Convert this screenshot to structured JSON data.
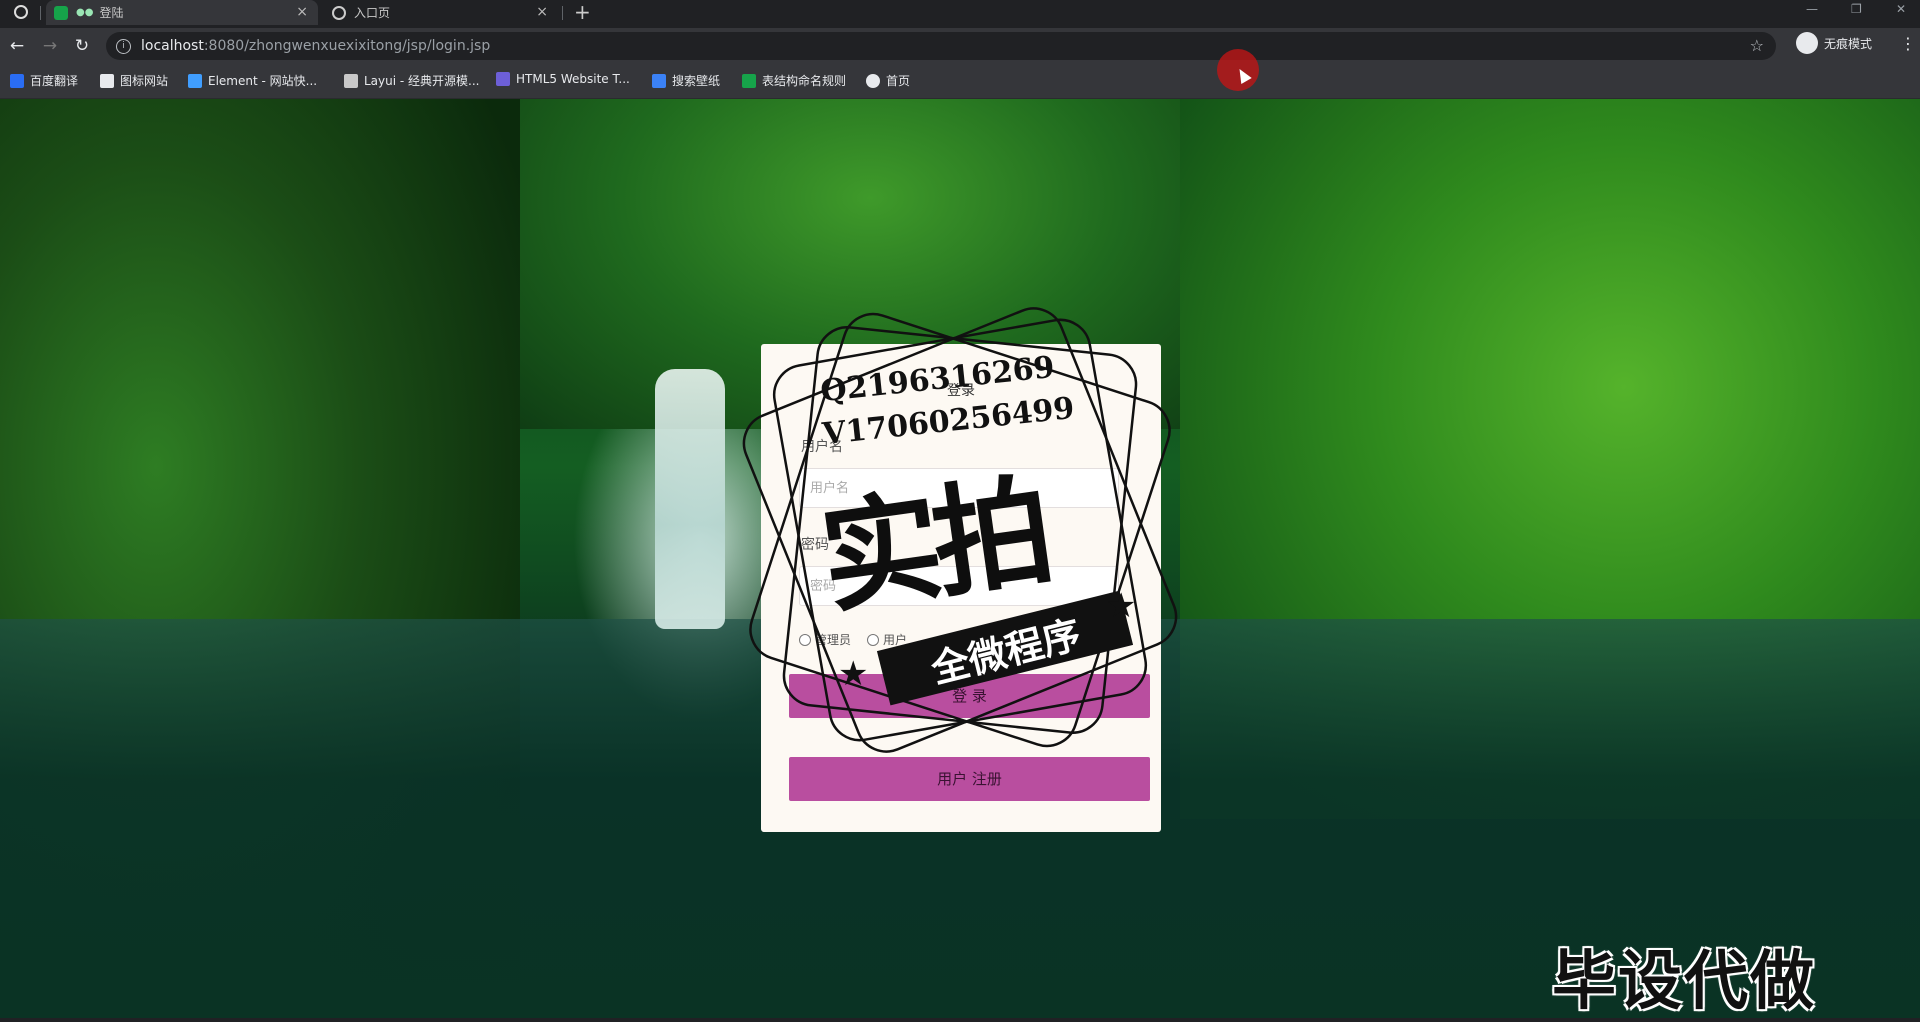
{
  "browser": {
    "tabs": [
      {
        "title": "登陆",
        "active": true
      },
      {
        "title": "入口页",
        "active": false
      }
    ],
    "new_tab_symbol": "+",
    "close_symbol": "×",
    "url": {
      "host": "localhost",
      "path": ":8080/zhongwenxuexixitong/jsp/login.jsp"
    },
    "profile_label": "无痕模式",
    "bookmarks": [
      {
        "label": "百度翻译",
        "icon": "baidu-translate-icon",
        "color": "#2a6df4"
      },
      {
        "label": "图标网站",
        "icon": "flag-icon",
        "color": "#e8eaed"
      },
      {
        "label": "Element - 网站快...",
        "icon": "element-icon",
        "color": "#409eff"
      },
      {
        "label": "Layui - 经典开源模...",
        "icon": "layui-icon",
        "color": "#c9c9c9"
      },
      {
        "label": "HTML5 Website T...",
        "icon": "html5-icon",
        "color": "#6d5fd7"
      },
      {
        "label": "搜索壁纸",
        "icon": "wallpaper-icon",
        "color": "#3b82f6"
      },
      {
        "label": "表结构命名规则",
        "icon": "sheet-icon",
        "color": "#16a34a"
      },
      {
        "label": "首页",
        "icon": "globe-icon",
        "color": "#e8eaed"
      }
    ]
  },
  "login": {
    "title": "登录",
    "username_label": "用户名",
    "username_placeholder": "用户名",
    "password_label": "密码",
    "password_placeholder": "密码",
    "roles": [
      "管理员",
      "用户"
    ],
    "login_button": "登 录",
    "register_button": "用户 注册",
    "accent_color": "#b94e9f"
  },
  "watermark": {
    "contact_q": "Q2196316269",
    "contact_v": "V17060256499",
    "big_text": "实拍",
    "ribbon_text": "全微程序",
    "corner_text": "毕设代做"
  }
}
